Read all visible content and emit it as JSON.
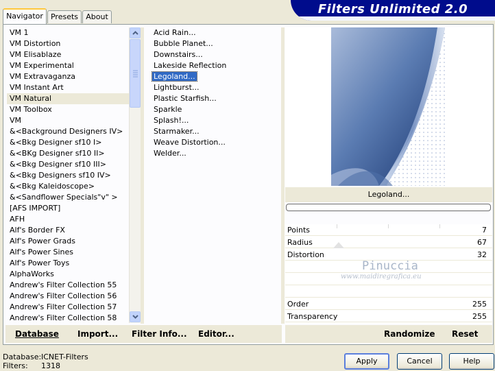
{
  "tabs": [
    "Navigator",
    "Presets",
    "About"
  ],
  "banner_title": "Filters Unlimited 2.0",
  "left_list": [
    "VM 1",
    "VM Distortion",
    "VM Elisablaze",
    "VM Experimental",
    "VM Extravaganza",
    "VM Instant Art",
    "VM Natural",
    "VM Toolbox",
    "VM",
    "&<Background Designers IV>",
    "&<Bkg Designer sf10 I>",
    "&<BKg Designer sf10 II>",
    "&<Bkg Designer sf10 III>",
    "&<Bkg Designers sf10 IV>",
    "&<Bkg Kaleidoscope>",
    "&<Sandflower Specials\"v\" >",
    "[AFS IMPORT]",
    "AFH",
    "Alf's Border FX",
    "Alf's Power Grads",
    "Alf's Power Sines",
    "Alf's Power Toys",
    "AlphaWorks",
    "Andrew's Filter Collection 55",
    "Andrew's Filter Collection 56",
    "Andrew's Filter Collection 57",
    "Andrew's Filter Collection 58"
  ],
  "left_selected": "VM Natural",
  "right_list": [
    "Acid Rain...",
    "Bubble Planet...",
    "Downstairs...",
    "Lakeside Reflection",
    "Legoland...",
    "Lightburst...",
    "Plastic Starfish...",
    "Sparkle",
    "Splash!...",
    "Starmaker...",
    "Weave Distortion...",
    "Welder..."
  ],
  "right_selected": "Legoland...",
  "preview_label": "Legoland...",
  "params": [
    {
      "name": "Points",
      "value": "7"
    },
    {
      "name": "Radius",
      "value": "67"
    },
    {
      "name": "Distortion",
      "value": "32"
    },
    {
      "name": "Order",
      "value": "255"
    },
    {
      "name": "Transparency",
      "value": "255"
    }
  ],
  "watermark": {
    "line1": "Pinuccia",
    "line2": "www.maidiregrafica.eu"
  },
  "left_buttons": {
    "database": "Database",
    "import": "Import...",
    "filter_info": "Filter Info...",
    "editor": "Editor..."
  },
  "right_buttons": {
    "randomize": "Randomize",
    "reset": "Reset"
  },
  "footer": {
    "db_label": "Database:",
    "db_value": "ICNET-Filters",
    "filters_label": "Filters:",
    "filters_value": "1318"
  },
  "dialog_buttons": {
    "apply": "Apply",
    "cancel": "Cancel",
    "help": "Help"
  }
}
